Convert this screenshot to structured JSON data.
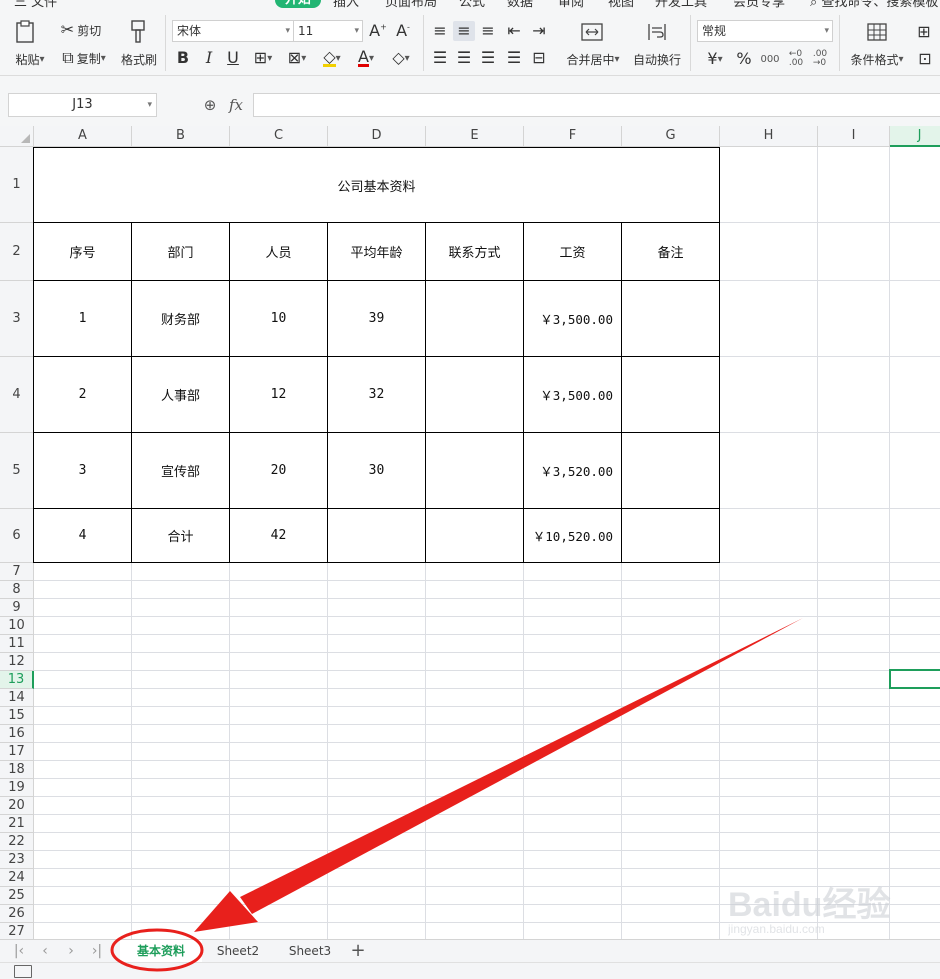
{
  "menu": {
    "items": [
      "三 文件",
      "开始",
      "插入",
      "页面布局",
      "公式",
      "数据",
      "审阅",
      "视图",
      "开发工具",
      "会员专享"
    ],
    "active_index": 1,
    "search_hint": "查找命令、搜索模板"
  },
  "ribbon": {
    "paste_label": "粘贴",
    "cut_label": "剪切",
    "copy_label": "复制",
    "format_painter_label": "格式刷",
    "font_name": "宋体",
    "font_size": "11",
    "merge_center_label": "合并居中",
    "wrap_text_label": "自动换行",
    "number_format": "常规",
    "conditional_format_label": "条件格式",
    "currency_symbol": "¥",
    "percent_symbol": "%",
    "thousands_symbol": "000"
  },
  "formula_bar": {
    "name_box": "J13",
    "fx_label": "fx",
    "value": ""
  },
  "grid": {
    "columns": [
      "A",
      "B",
      "C",
      "D",
      "E",
      "F",
      "G",
      "H",
      "I",
      "J"
    ],
    "active_column": "J",
    "rows": [
      "1",
      "2",
      "3",
      "4",
      "5",
      "6",
      "7",
      "8",
      "9",
      "10",
      "11",
      "12",
      "13",
      "14",
      "15",
      "16",
      "17",
      "18",
      "19",
      "20",
      "21",
      "22",
      "23",
      "24",
      "25",
      "26",
      "27"
    ],
    "active_row": "13"
  },
  "table": {
    "title": "公司基本资料",
    "headers": [
      "序号",
      "部门",
      "人员",
      "平均年龄",
      "联系方式",
      "工资",
      "备注"
    ],
    "rows": [
      [
        "1",
        "财务部",
        "10",
        "39",
        "",
        "￥3,500.00",
        ""
      ],
      [
        "2",
        "人事部",
        "12",
        "32",
        "",
        "￥3,500.00",
        ""
      ],
      [
        "3",
        "宣传部",
        "20",
        "30",
        "",
        "￥3,520.00",
        ""
      ],
      [
        "4",
        "合计",
        "42",
        "",
        "",
        "￥10,520.00",
        ""
      ]
    ]
  },
  "sheets": {
    "tabs": [
      "基本资料",
      "Sheet2",
      "Sheet3"
    ],
    "active_index": 0,
    "add_label": "+"
  },
  "annotation": {
    "color": "#e8201c"
  },
  "watermark": {
    "brand": "Baidu经验",
    "url": "jingyan.baidu.com"
  }
}
